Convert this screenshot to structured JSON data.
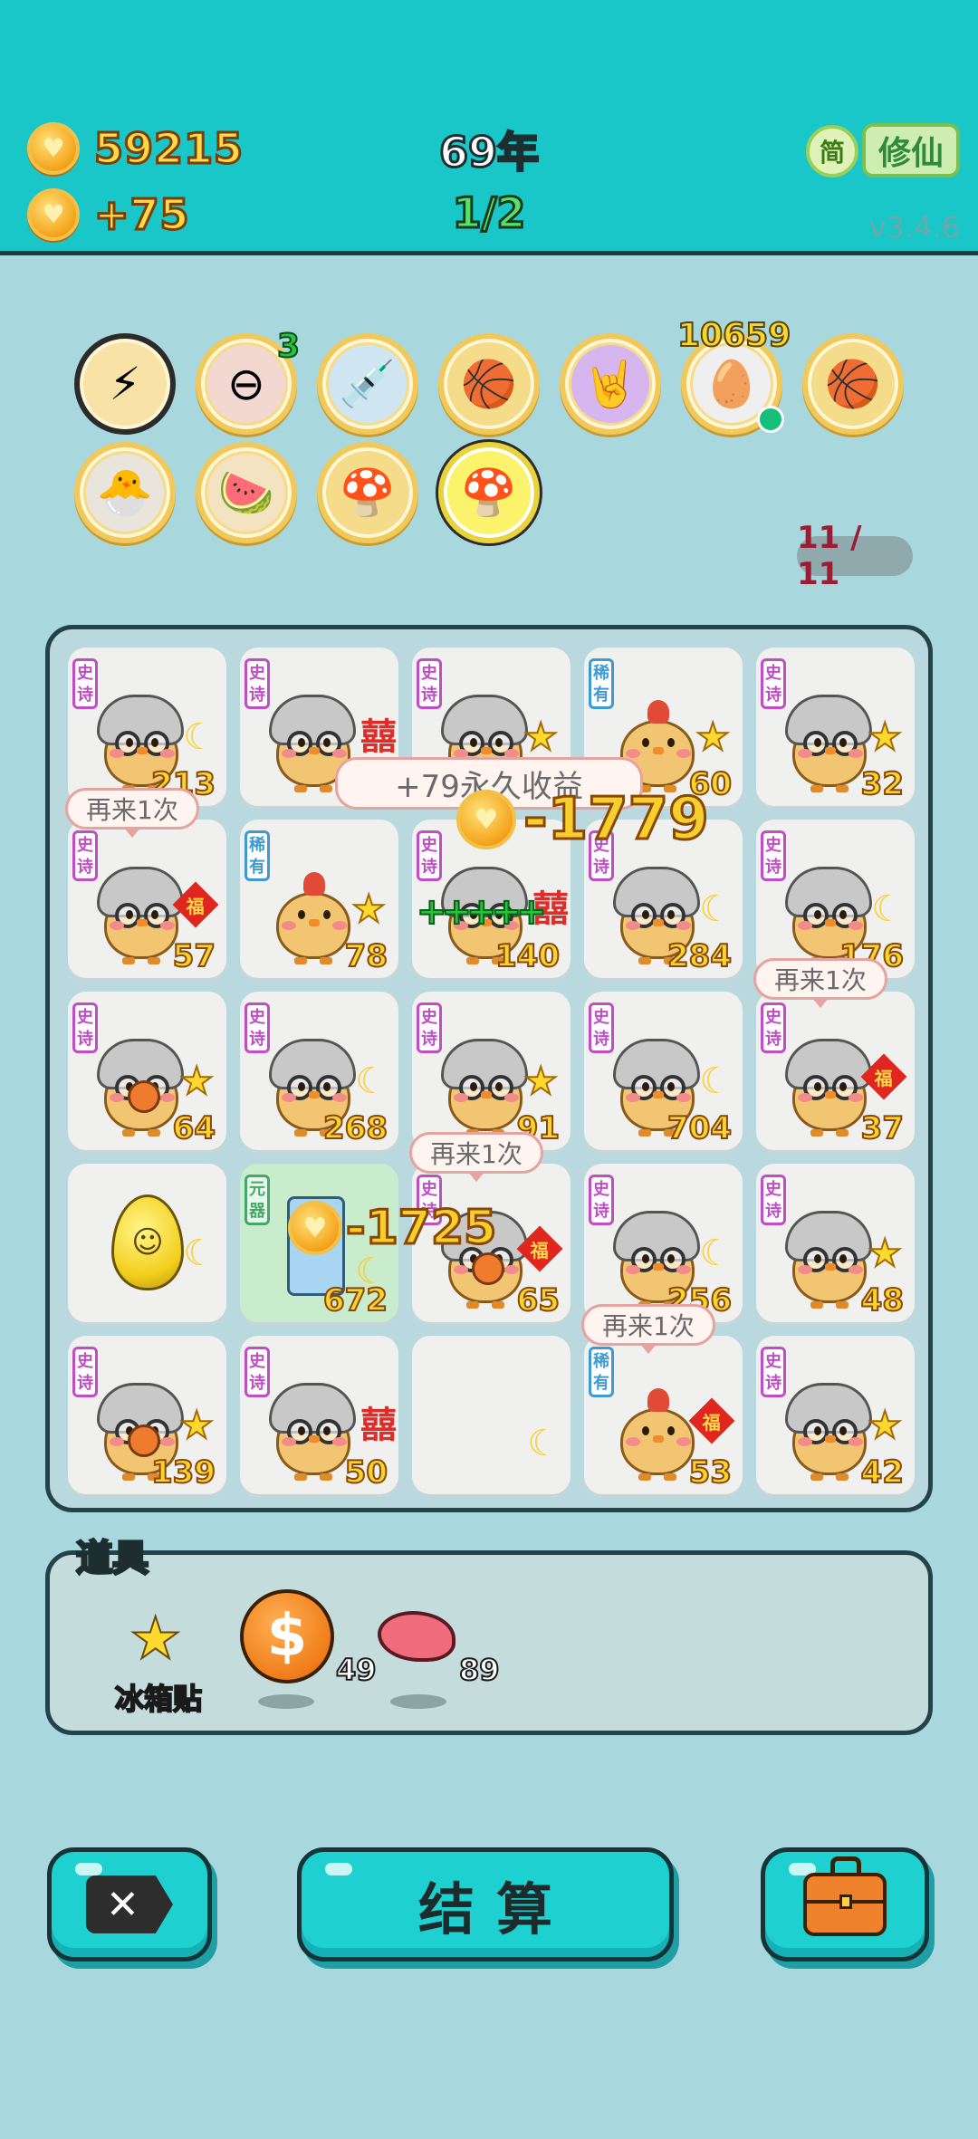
{
  "header": {
    "gold": "59215",
    "income": "+75",
    "year": "69年",
    "turn": "1/2",
    "lang_button": "简",
    "mode_button": "修仙",
    "version": "v3.4.6"
  },
  "relics": {
    "items": [
      {
        "name": "lightning-pin",
        "icon": "⚡"
      },
      {
        "name": "minus-coin",
        "icon": "⊖",
        "badge": "3"
      },
      {
        "name": "syringe-chick",
        "icon": "💉"
      },
      {
        "name": "three-basketballs",
        "icon": "🏀"
      },
      {
        "name": "rock-hand",
        "icon": "🤘"
      },
      {
        "name": "egg-tray",
        "icon": "🥚",
        "badge": "10659"
      },
      {
        "name": "three-basketballs-2",
        "icon": "🏀"
      },
      {
        "name": "chick-with-egg",
        "icon": "🐣"
      },
      {
        "name": "fruit-bowl",
        "icon": "🍉"
      },
      {
        "name": "mushroom-cloud",
        "icon": "🍄"
      },
      {
        "name": "mushroom-cloud-selected",
        "icon": "🍄"
      }
    ],
    "count": "11 / 11"
  },
  "board": {
    "cells": [
      {
        "rarity": "史诗",
        "num": "213",
        "acc": "moon",
        "type": "chick-old"
      },
      {
        "rarity": "史诗",
        "num": "",
        "acc": "xi",
        "type": "chick-old"
      },
      {
        "rarity": "史诗",
        "num": "",
        "acc": "star",
        "type": "chick-old"
      },
      {
        "rarity": "稀有",
        "num": "60",
        "acc": "star",
        "type": "chick"
      },
      {
        "rarity": "史诗",
        "num": "32",
        "acc": "star",
        "type": "chick-old"
      },
      {
        "rarity": "史诗",
        "num": "57",
        "acc": "fu",
        "type": "chick-old"
      },
      {
        "rarity": "稀有",
        "num": "78",
        "acc": "star",
        "type": "chick"
      },
      {
        "rarity": "史诗",
        "num": "140",
        "acc": "xi",
        "type": "chick-old"
      },
      {
        "rarity": "史诗",
        "num": "284",
        "acc": "moon",
        "type": "chick-old"
      },
      {
        "rarity": "史诗",
        "num": "176",
        "acc": "moon",
        "type": "chick-old"
      },
      {
        "rarity": "史诗",
        "num": "64",
        "acc": "star",
        "type": "chick-old-ball"
      },
      {
        "rarity": "史诗",
        "num": "268",
        "acc": "moon",
        "type": "chick-old"
      },
      {
        "rarity": "史诗",
        "num": "91",
        "acc": "star",
        "type": "chick-old"
      },
      {
        "rarity": "史诗",
        "num": "704",
        "acc": "moon",
        "type": "chick-old"
      },
      {
        "rarity": "史诗",
        "num": "37",
        "acc": "fu",
        "type": "chick-old"
      },
      {
        "rarity": "",
        "num": "",
        "acc": "moon",
        "type": "egg"
      },
      {
        "rarity": "元器",
        "num": "672",
        "acc": "moon",
        "type": "fridge"
      },
      {
        "rarity": "史诗",
        "num": "65",
        "acc": "fu",
        "type": "chick-old-ball"
      },
      {
        "rarity": "史诗",
        "num": "256",
        "acc": "moon",
        "type": "chick-old"
      },
      {
        "rarity": "史诗",
        "num": "48",
        "acc": "star",
        "type": "chick-old"
      },
      {
        "rarity": "史诗",
        "num": "139",
        "acc": "star",
        "type": "chick-old-ball"
      },
      {
        "rarity": "史诗",
        "num": "50",
        "acc": "xi",
        "type": "chick-old"
      },
      {
        "rarity": "",
        "num": "",
        "acc": "moon",
        "type": "empty"
      },
      {
        "rarity": "稀有",
        "num": "53",
        "acc": "fu",
        "type": "chick"
      },
      {
        "rarity": "史诗",
        "num": "42",
        "acc": "star",
        "type": "chick-old"
      }
    ],
    "overlays": {
      "perm_income": "+79永久收益",
      "float_big": "-1779",
      "float_small": "-1725",
      "again": "再来1次",
      "sparkle": "+++++"
    },
    "fu_char": "福",
    "xi_char": "囍"
  },
  "items_panel": {
    "title": "道具",
    "sticker_label": "冰箱贴",
    "coin_count": "49",
    "liver_count": "89"
  },
  "buttons": {
    "settle": "结算"
  },
  "colors": {
    "header_bg": "#19c6c8",
    "page_bg": "#a8d8de",
    "gold_text": "#ffd94a",
    "turn_text": "#58e06a",
    "button_bg": "#1fd0d0"
  }
}
